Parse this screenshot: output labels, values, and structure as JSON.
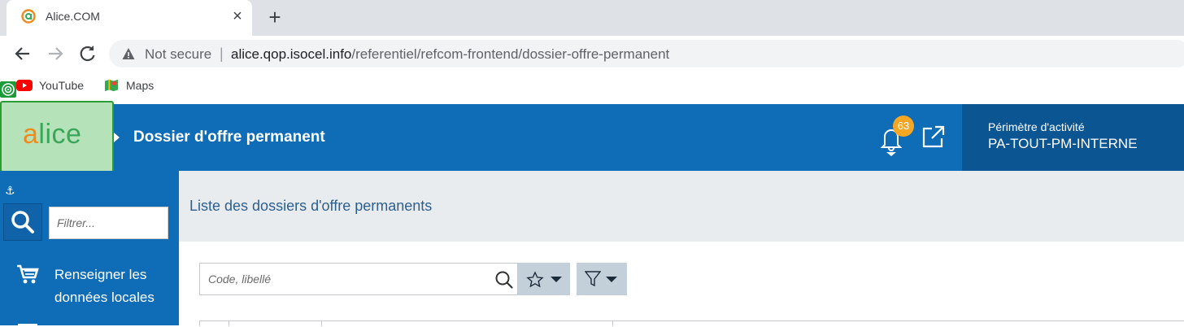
{
  "browser": {
    "tab_title": "Alice.COM",
    "tab_close": "×",
    "new_tab": "+",
    "security_label": "Not secure",
    "separator": "|",
    "url_host": "alice.qop.isocel.info",
    "url_path": "/referentiel/refcom-frontend/dossier-offre-permanent",
    "bookmarks": [
      {
        "label": "YouTube",
        "icon": "youtube-icon"
      },
      {
        "label": "Maps",
        "icon": "maps-icon"
      }
    ]
  },
  "header": {
    "logo_prefix": "a",
    "logo_rest": "lice",
    "page_title": "Dossier d'offre permanent",
    "notification_count": "63",
    "perimeter_label": "Périmètre d'activité",
    "perimeter_value": "PA-TOUT-PM-INTERNE",
    "colors": {
      "header_bg": "#0f6db8",
      "perimeter_bg": "#0b5592",
      "badge": "#f5a623"
    }
  },
  "sidebar": {
    "anchor": "⚓",
    "filter_placeholder": "Filtrer...",
    "menu_item_label": "Renseigner les données locales"
  },
  "main": {
    "list_title": "Liste des dossiers d'offre permanents",
    "search_placeholder": "Code, libellé"
  }
}
